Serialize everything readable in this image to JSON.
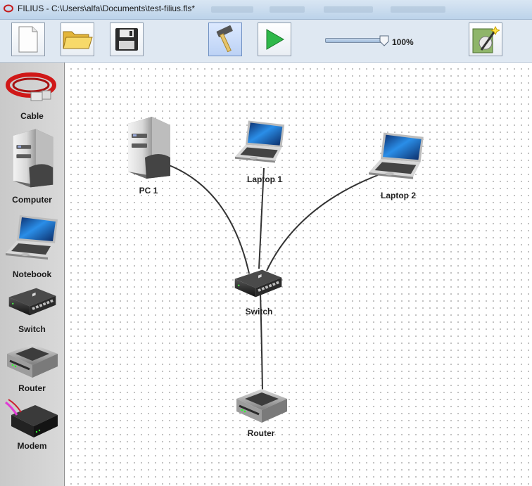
{
  "window": {
    "title": "FILIUS - C:\\Users\\alfa\\Documents\\test-filius.fls*"
  },
  "toolbar": {
    "buttons": [
      {
        "name": "new-file",
        "icon": "new-document-icon"
      },
      {
        "name": "open-file",
        "icon": "open-folder-icon"
      },
      {
        "name": "save-file",
        "icon": "save-disk-icon"
      },
      {
        "name": "design-mode",
        "icon": "hammer-icon",
        "active": true
      },
      {
        "name": "simulation-mode",
        "icon": "play-icon"
      },
      {
        "name": "wizard",
        "icon": "wizard-wand-icon"
      }
    ],
    "zoom_label": "100%",
    "zoom_level": 1.0
  },
  "palette": {
    "items": [
      {
        "label": "Cable",
        "icon": "cable-icon"
      },
      {
        "label": "Computer",
        "icon": "computer-icon"
      },
      {
        "label": "Notebook",
        "icon": "notebook-icon"
      },
      {
        "label": "Switch",
        "icon": "switch-icon"
      },
      {
        "label": "Router",
        "icon": "router-icon"
      },
      {
        "label": "Modem",
        "icon": "modem-icon"
      }
    ]
  },
  "network": {
    "nodes": [
      {
        "id": "pc1",
        "label": "PC 1",
        "type": "computer"
      },
      {
        "id": "laptop1",
        "label": "Laptop 1",
        "type": "notebook"
      },
      {
        "id": "laptop2",
        "label": "Laptop 2",
        "type": "notebook"
      },
      {
        "id": "switch",
        "label": "Switch",
        "type": "switch"
      },
      {
        "id": "router",
        "label": "Router",
        "type": "router"
      }
    ],
    "cables": [
      {
        "from": "pc1",
        "to": "switch"
      },
      {
        "from": "laptop1",
        "to": "switch"
      },
      {
        "from": "laptop2",
        "to": "switch"
      },
      {
        "from": "switch",
        "to": "router"
      }
    ]
  },
  "colors": {
    "cable_palette_icon": "#d01818",
    "play_green": "#2fb84a",
    "canvas_dot": "#b6b6b6"
  }
}
